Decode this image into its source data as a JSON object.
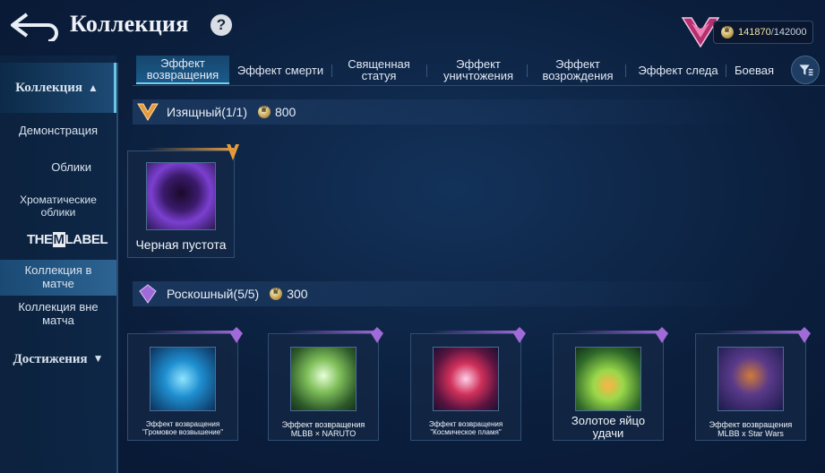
{
  "header": {
    "title": "Коллекция",
    "help": "?",
    "points_current": "141870",
    "points_separator": "/",
    "points_max": "142000"
  },
  "sidebar": {
    "collection": "Коллекция",
    "demo": "Демонстрация",
    "skins": "Облики",
    "chromatic": "Хроматические облики",
    "label_them": "THE",
    "label_m": "M",
    "label_rest": "LABEL",
    "in_match": "Коллекция в матче",
    "out_match": "Коллекция вне матча",
    "achievements": "Достижения"
  },
  "tabs": [
    "Эффект возвращения",
    "Эффект смерти",
    "Священная статуя",
    "Эффект уничтожения",
    "Эффект возрождения",
    "Эффект следа",
    "Боевая"
  ],
  "sections": {
    "elegant": {
      "title": "Изящный(1/1)",
      "cost": "800"
    },
    "deluxe": {
      "title": "Роскошный(5/5)",
      "cost": "300"
    }
  },
  "items": {
    "elegant": [
      {
        "name": "Черная пустота"
      }
    ],
    "deluxe": [
      {
        "name": "Эффект возвращения \"Громовое возвышение\""
      },
      {
        "name": "Эффект возвращения MLBB × NARUTO"
      },
      {
        "name": "Эффект возвращения \"Космическое пламя\""
      },
      {
        "name": "Золотое яйцо удачи"
      },
      {
        "name": "Эффект возвращения MLBB x Star Wars"
      }
    ]
  },
  "colors": {
    "elegant_accent": "#e79a3c",
    "deluxe_accent": "#a06ad8",
    "active_tab_accent": "#6fd0f0"
  },
  "icons": [
    "back-arrow-icon",
    "help-icon",
    "rank-emblem-icon",
    "coin-icon",
    "filter-icon",
    "chevron-up-icon",
    "chevron-down-icon"
  ]
}
